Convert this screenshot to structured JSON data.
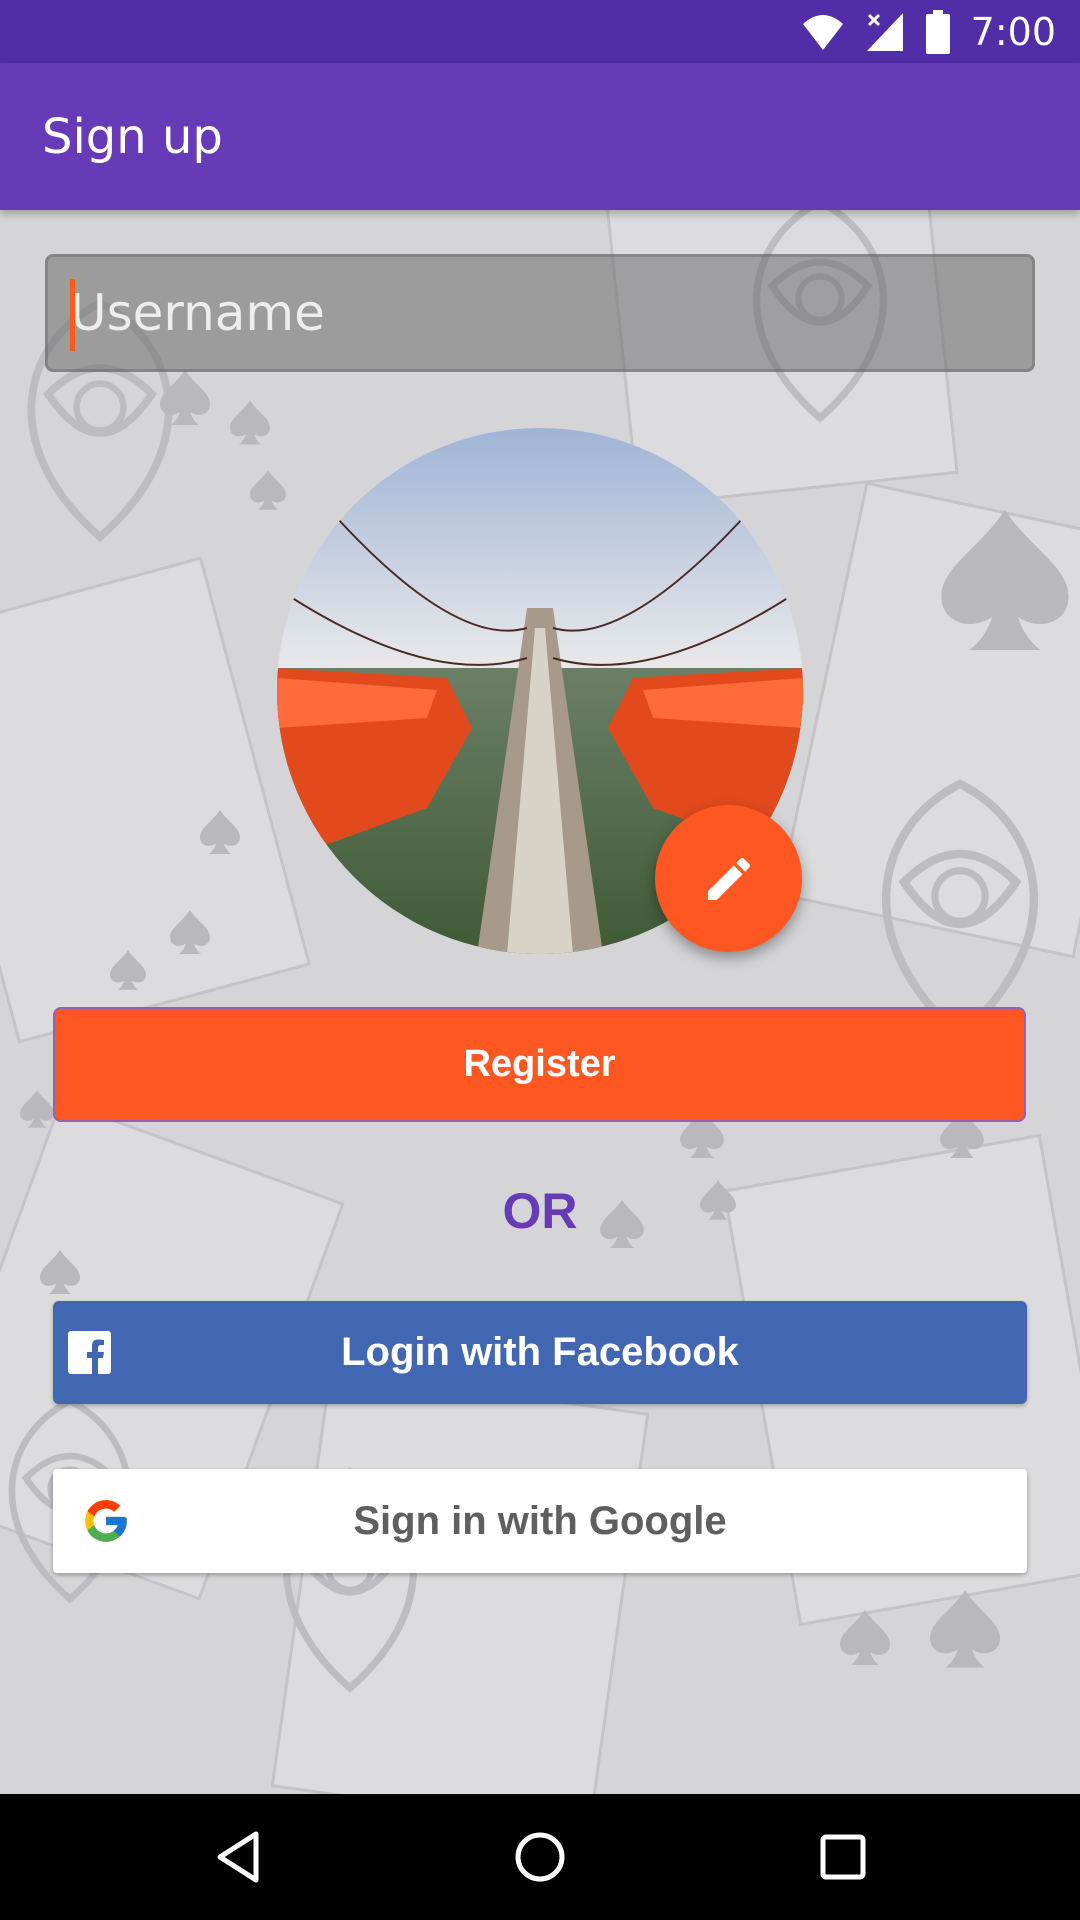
{
  "status_bar": {
    "time": "7:00"
  },
  "app_bar": {
    "title": "Sign up"
  },
  "form": {
    "username_placeholder": "Username",
    "username_value": "",
    "register_label": "Register",
    "or_label": "OR",
    "facebook_label": "Login with Facebook",
    "google_label": "Sign in with Google"
  },
  "icons": {
    "status": [
      "wifi-icon",
      "signal-icon",
      "battery-icon"
    ],
    "edit": "pencil-icon",
    "facebook": "facebook-icon",
    "google": "google-icon",
    "nav": [
      "back-icon",
      "home-icon",
      "recents-icon"
    ]
  },
  "colors": {
    "primary": "#673ab7",
    "primary_dark": "#512da8",
    "accent": "#ff5722",
    "facebook": "#4267b2",
    "google_text": "#5f5f5f"
  }
}
